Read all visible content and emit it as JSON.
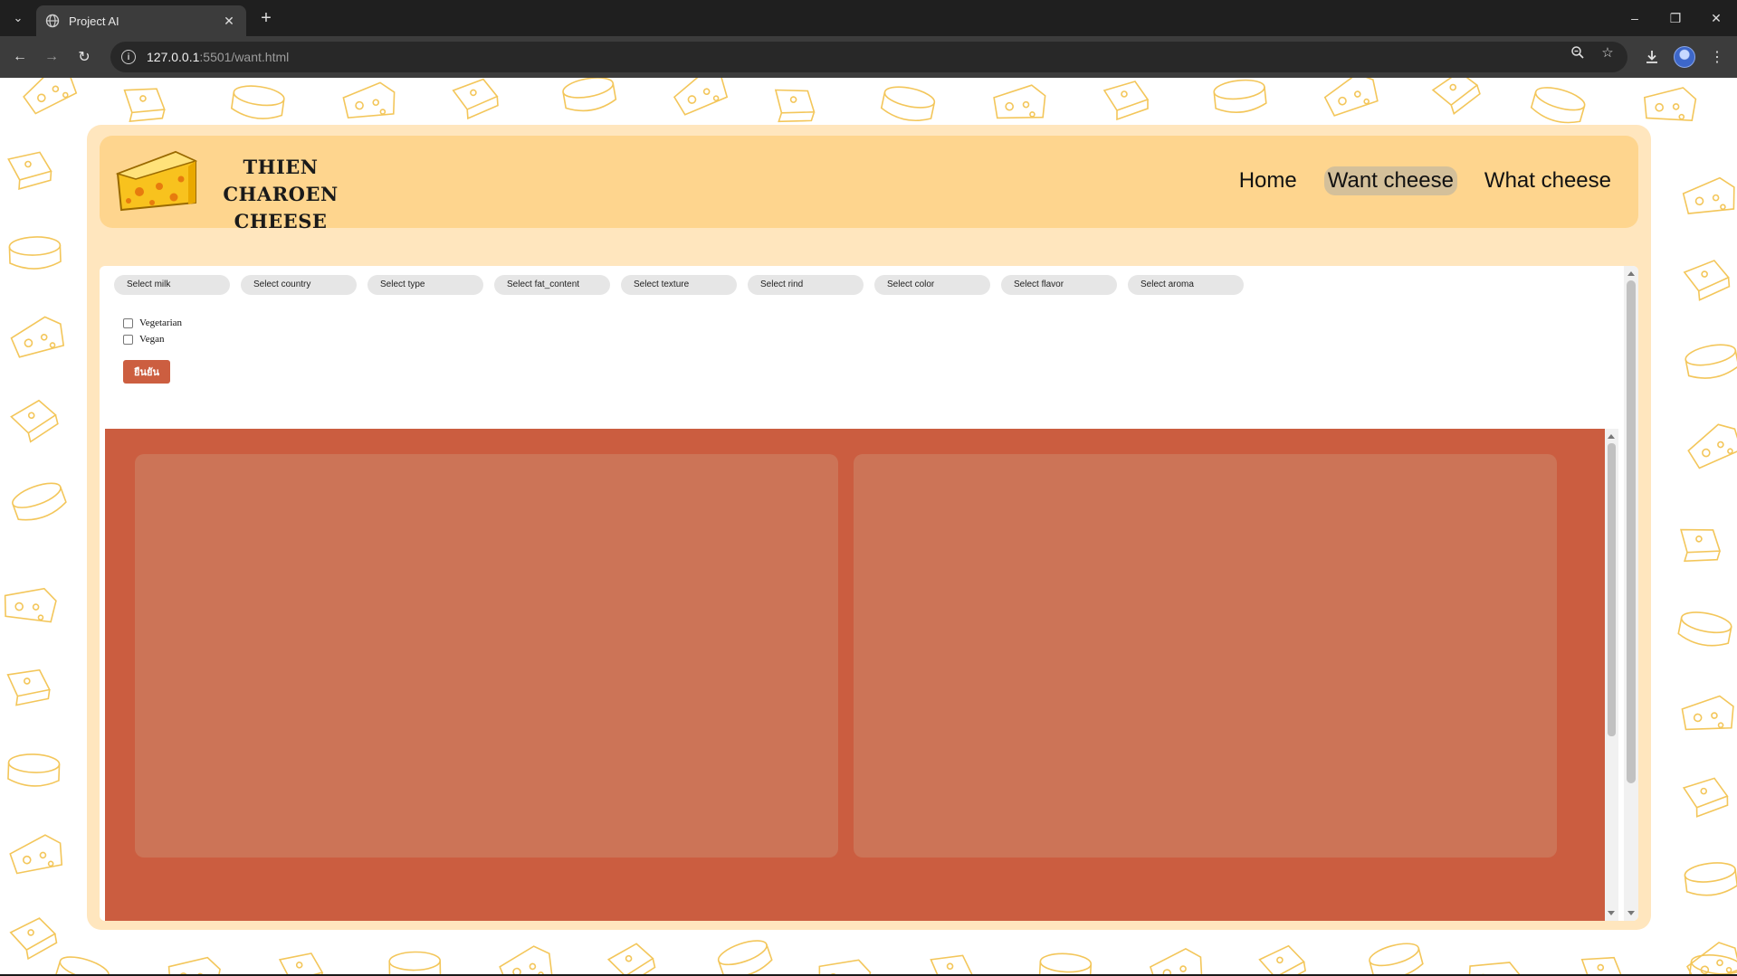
{
  "browser": {
    "tab_title": "Project AI",
    "url_host": "127.0.0.1",
    "url_rest": ":5501/want.html"
  },
  "site": {
    "brand_line1": "THIEN CHAROEN",
    "brand_line2": "CHEESE",
    "nav": [
      "Home",
      "Want cheese",
      "What cheese"
    ],
    "active_nav": "Want cheese"
  },
  "filters": [
    "Select milk",
    "Select country",
    "Select type",
    "Select fat_content",
    "Select texture",
    "Select rind",
    "Select color",
    "Select flavor",
    "Select aroma"
  ],
  "checkboxes": [
    {
      "label": "Vegetarian",
      "checked": false
    },
    {
      "label": "Vegan",
      "checked": false
    }
  ],
  "confirm_button": "ยืนยัน",
  "colors": {
    "page_bg": "#ffffff",
    "card_bg": "#ffe6be",
    "header_bg": "#fed58e",
    "results_bg": "#cb5d40",
    "result_card_bg": "#cc7457",
    "button_bg": "#cc5e40",
    "doodle_stroke": "#f3c65a"
  },
  "icons": [
    "tab-list-icon",
    "globe-icon",
    "close-icon",
    "plus-icon",
    "back-icon",
    "forward-icon",
    "reload-icon",
    "info-icon",
    "zoom-icon",
    "star-icon",
    "download-icon",
    "menu-icon",
    "cheese-logo-icon"
  ]
}
